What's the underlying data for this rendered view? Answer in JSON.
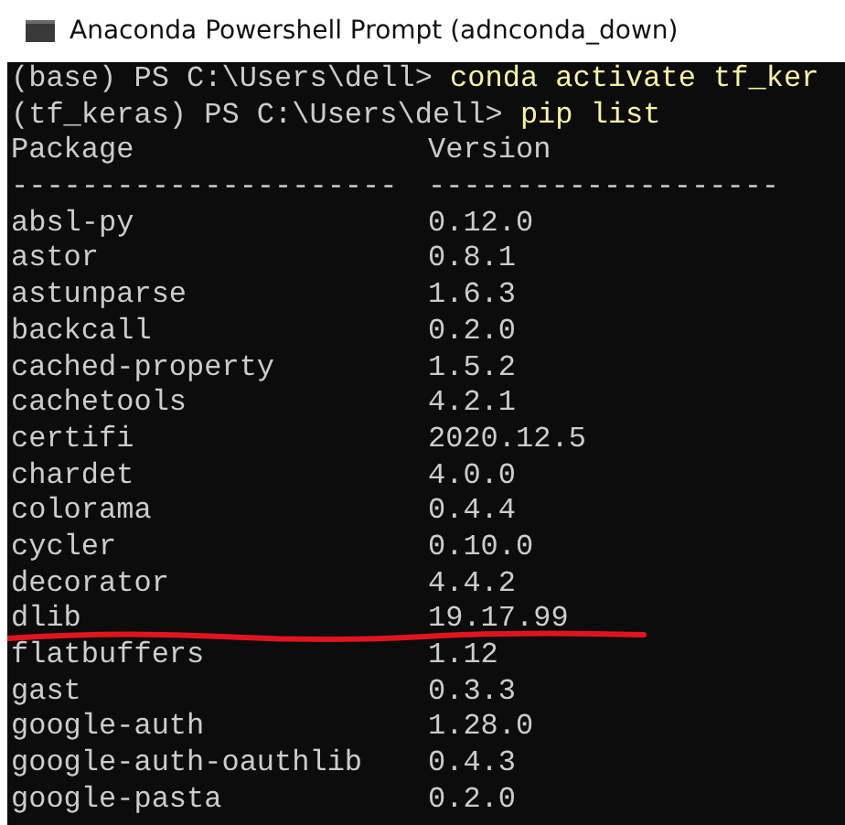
{
  "window": {
    "title": "Anaconda Powershell Prompt (adnconda_down)"
  },
  "commands": [
    {
      "prompt": "(base) PS C:\\Users\\dell>",
      "input": "conda activate tf_ker"
    },
    {
      "prompt": "(tf_keras) PS C:\\Users\\dell>",
      "input": "pip list"
    }
  ],
  "table": {
    "columns": [
      "Package",
      "Version"
    ],
    "rules": [
      "----------------------",
      "--------------------"
    ],
    "rows": [
      {
        "package": "absl-py",
        "version": "0.12.0",
        "underlined": false
      },
      {
        "package": "astor",
        "version": "0.8.1",
        "underlined": false
      },
      {
        "package": "astunparse",
        "version": "1.6.3",
        "underlined": false
      },
      {
        "package": "backcall",
        "version": "0.2.0",
        "underlined": false
      },
      {
        "package": "cached-property",
        "version": "1.5.2",
        "underlined": false
      },
      {
        "package": "cachetools",
        "version": "4.2.1",
        "underlined": false
      },
      {
        "package": "certifi",
        "version": "2020.12.5",
        "underlined": false
      },
      {
        "package": "chardet",
        "version": "4.0.0",
        "underlined": false
      },
      {
        "package": "colorama",
        "version": "0.4.4",
        "underlined": false
      },
      {
        "package": "cycler",
        "version": "0.10.0",
        "underlined": false
      },
      {
        "package": "decorator",
        "version": "4.4.2",
        "underlined": false
      },
      {
        "package": "dlib",
        "version": "19.17.99",
        "underlined": true
      },
      {
        "package": "flatbuffers",
        "version": "1.12",
        "underlined": false
      },
      {
        "package": "gast",
        "version": "0.3.3",
        "underlined": false
      },
      {
        "package": "google-auth",
        "version": "1.28.0",
        "underlined": false
      },
      {
        "package": "google-auth-oauthlib",
        "version": "0.4.3",
        "underlined": false
      },
      {
        "package": "google-pasta",
        "version": "0.2.0",
        "underlined": false
      }
    ]
  }
}
